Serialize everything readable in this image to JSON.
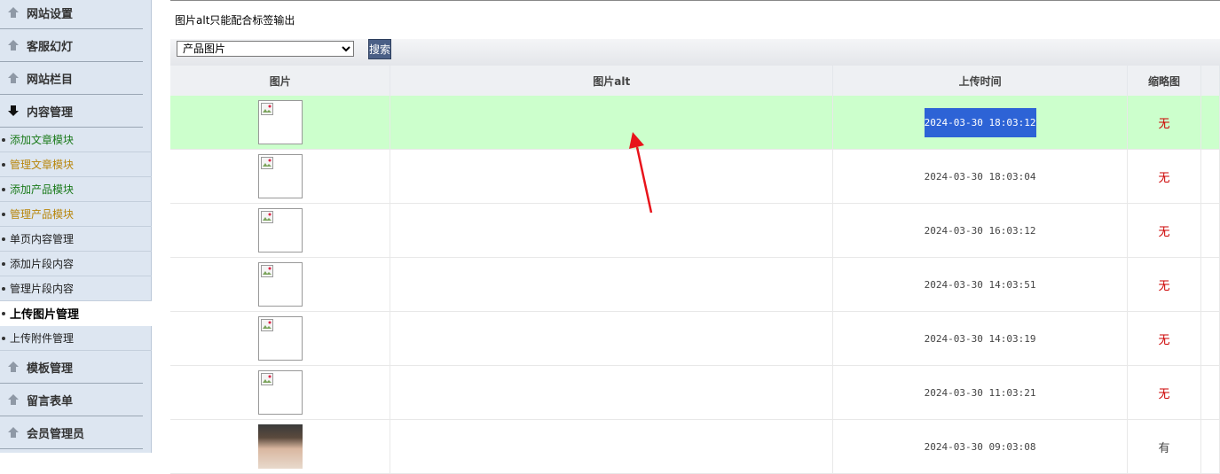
{
  "sidebar": {
    "sections_top": [
      {
        "label": "网站设置",
        "icon": "arrow-up-icon"
      },
      {
        "label": "客服幻灯",
        "icon": "arrow-up-icon"
      },
      {
        "label": "网站栏目",
        "icon": "arrow-up-icon"
      },
      {
        "label": "内容管理",
        "icon": "arrow-down-icon"
      }
    ],
    "items": [
      {
        "label": "添加文章模块",
        "color": "#1a7a1a"
      },
      {
        "label": "管理文章模块",
        "color": "#b8860b"
      },
      {
        "label": "添加产品模块",
        "color": "#1a7a1a"
      },
      {
        "label": "管理产品模块",
        "color": "#b8860b"
      },
      {
        "label": "单页内容管理",
        "color": "#222222"
      },
      {
        "label": "添加片段内容",
        "color": "#222222"
      },
      {
        "label": "管理片段内容",
        "color": "#222222"
      },
      {
        "label": "上传图片管理",
        "color": "#000000",
        "active": true
      },
      {
        "label": "上传附件管理",
        "color": "#222222"
      }
    ],
    "sections_bottom": [
      {
        "label": "模板管理",
        "icon": "arrow-up-icon"
      },
      {
        "label": "留言表单",
        "icon": "arrow-up-icon"
      },
      {
        "label": "会员管理员",
        "icon": "arrow-up-icon"
      }
    ]
  },
  "notice": "图片alt只能配合标签输出",
  "filter": {
    "selected": "产品图片",
    "search_label": "搜索"
  },
  "table": {
    "headers": [
      "图片",
      "图片alt",
      "上传时间",
      "缩略图"
    ],
    "rows": [
      {
        "image": "broken",
        "alt": "",
        "time": "2024-03-30 18:03:12",
        "thumb": "无",
        "highlighted": true,
        "time_selected": true
      },
      {
        "image": "broken",
        "alt": "",
        "time": "2024-03-30 18:03:04",
        "thumb": "无"
      },
      {
        "image": "broken",
        "alt": "",
        "time": "2024-03-30 16:03:12",
        "thumb": "无"
      },
      {
        "image": "broken",
        "alt": "",
        "time": "2024-03-30 14:03:51",
        "thumb": "无"
      },
      {
        "image": "broken",
        "alt": "",
        "time": "2024-03-30 14:03:19",
        "thumb": "无"
      },
      {
        "image": "broken",
        "alt": "",
        "time": "2024-03-30 11:03:21",
        "thumb": "无"
      },
      {
        "image": "photo",
        "alt": "",
        "time": "2024-03-30 09:03:08",
        "thumb": "有"
      }
    ]
  },
  "colors": {
    "highlight_row": "#ccffcc",
    "none_mark": "#cc0000",
    "annotation_arrow": "#e8141b"
  }
}
